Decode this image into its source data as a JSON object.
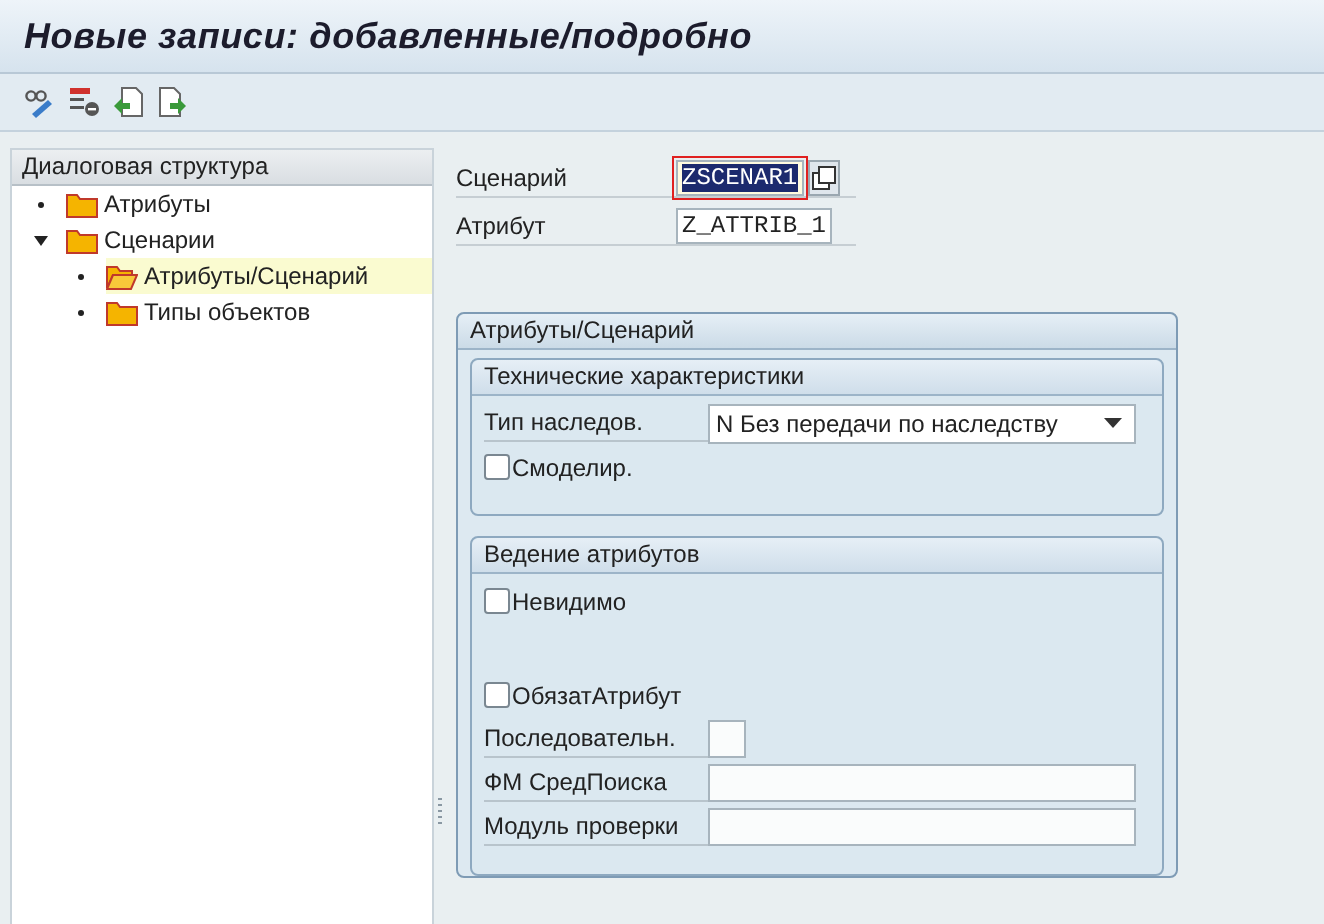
{
  "window": {
    "title": "Новые записи: добавленные/подробно"
  },
  "navigation": {
    "title": "Диалоговая структура",
    "items": [
      {
        "label": "Атрибуты",
        "expanded": false,
        "selected": false
      },
      {
        "label": "Сценарии",
        "expanded": true,
        "selected": false,
        "children": [
          {
            "label": "Атрибуты/Сценарий",
            "expanded": false,
            "selected": true
          },
          {
            "label": "Типы объектов",
            "expanded": false,
            "selected": false
          }
        ]
      }
    ]
  },
  "header_fields": [
    {
      "label": "Сценарий",
      "value": "ZSCENAR1",
      "focused": true
    },
    {
      "label": "Атрибут",
      "value": "Z_ATTRIB_1",
      "focused": false
    }
  ],
  "group": {
    "title": "Атрибуты/Сценарий",
    "sections": [
      {
        "title": "Технические характеристики",
        "rows": [
          {
            "kind": "dropdown",
            "label": "Тип наследов.",
            "value": "N Без передачи по наследству"
          },
          {
            "kind": "checkbox",
            "label": "Смоделир.",
            "checked": false
          }
        ]
      },
      {
        "title": "Ведение атрибутов",
        "rows": [
          {
            "kind": "checkbox",
            "label": "Невидимо",
            "checked": false
          },
          {
            "kind": "gap"
          },
          {
            "kind": "checkbox",
            "label": "ОбязатАтрибут",
            "checked": false
          },
          {
            "kind": "short-field",
            "label": "Последовательн."
          },
          {
            "kind": "field",
            "label": "ФМ СредПоиска"
          },
          {
            "kind": "field",
            "label": "Модуль проверки"
          }
        ]
      }
    ]
  }
}
